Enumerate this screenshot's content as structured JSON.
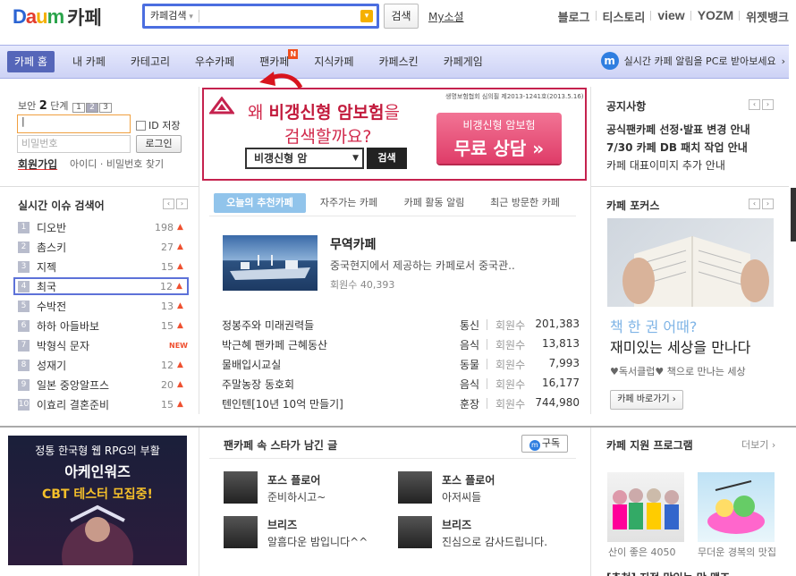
{
  "header": {
    "logo_brand": "Daum",
    "logo_service": "카페",
    "search_scope": "카페검색",
    "search_value": "",
    "search_button": "검색",
    "my_social": "My소셜",
    "links": [
      "블로그",
      "티스토리",
      "view",
      "yozm",
      "위젯뱅크"
    ]
  },
  "nav": {
    "items": [
      "카페 홈",
      "내 카페",
      "카테고리",
      "우수카페",
      "팬카페",
      "지식카페",
      "카페스킨",
      "카페게임"
    ],
    "new_badge": "N",
    "promo_icon": "m",
    "promo": "실시간 카페 알림을 PC로 받아보세요",
    "promo_arrow": "›"
  },
  "login": {
    "security_prefix": "보안",
    "security_level": "2",
    "security_suffix": "단계",
    "levels": [
      "1",
      "2",
      "3"
    ],
    "id_value": "|",
    "password_placeholder": "비밀번호",
    "save_id": "ID 저장",
    "login_button": "로그인",
    "join": "회원가입",
    "find": "아이디 · 비밀번호 찾기"
  },
  "ad": {
    "note": "생명보험협회 심의필 제2013-1241호(2013.5.16)",
    "line1_a": "왜 ",
    "line1_b": "비갱신형 암보험",
    "line1_c": "을",
    "line2": "검색할까요?",
    "select": "비갱신형 암",
    "search": "검색",
    "cta_small": "비갱신형 암보험",
    "cta_big": "무료 상담 »"
  },
  "notice": {
    "title": "공지사항",
    "items": [
      "공식팬카페 선정·발표 변경 안내",
      "7/30 카페 DB 패치 작업 안내",
      "카페 대표이미지 추가 안내"
    ]
  },
  "pager": {
    "prev": "‹",
    "next": "›"
  },
  "issues": {
    "title": "실시간 이슈 검색어",
    "up_marker": "▲",
    "items": [
      {
        "rank": "1",
        "keyword": "디오반",
        "count": "198",
        "trend": "up"
      },
      {
        "rank": "2",
        "keyword": "촘스키",
        "count": "27",
        "trend": "up"
      },
      {
        "rank": "3",
        "keyword": "지젝",
        "count": "15",
        "trend": "up"
      },
      {
        "rank": "4",
        "keyword": "최국",
        "count": "12",
        "trend": "up"
      },
      {
        "rank": "5",
        "keyword": "수박전",
        "count": "13",
        "trend": "up"
      },
      {
        "rank": "6",
        "keyword": "하하 아들바보",
        "count": "15",
        "trend": "up"
      },
      {
        "rank": "7",
        "keyword": "박형식 문자",
        "count": "",
        "trend": "NEW"
      },
      {
        "rank": "8",
        "keyword": "성재기",
        "count": "12",
        "trend": "up"
      },
      {
        "rank": "9",
        "keyword": "일본 중앙알프스",
        "count": "20",
        "trend": "up"
      },
      {
        "rank": "10",
        "keyword": "이효리 결혼준비",
        "count": "15",
        "trend": "up"
      }
    ]
  },
  "center": {
    "tabs": [
      "오늘의 추천카페",
      "자주가는 카페",
      "카페 활동 알림",
      "최근 방문한 카페"
    ],
    "feature": {
      "title": "무역카페",
      "desc": "중국현지에서 제공하는 카페로서 중국관..",
      "members_label": "회원수",
      "members": "40,393"
    },
    "member_label": "회원수",
    "rows": [
      {
        "name": "정봉주와 미래권력들",
        "cat": "통신",
        "members": "201,383"
      },
      {
        "name": "박근혜 팬카페 근혜동산",
        "cat": "음식",
        "members": "13,813"
      },
      {
        "name": "물배입시교실",
        "cat": "동물",
        "members": "7,993"
      },
      {
        "name": "주말농장 동호회",
        "cat": "음식",
        "members": "16,177"
      },
      {
        "name": "텐인텐[10년 10억 만들기]",
        "cat": "훈장",
        "members": "744,980"
      }
    ]
  },
  "focus": {
    "title": "카페 포커스",
    "headline": "책 한 권 어때?",
    "headline2": "재미있는 세상을 만나다",
    "sub": "♥독서클럽♥ 책으로 만나는 세상",
    "button": "카페 바로가기 ›"
  },
  "game_ad": {
    "line1": "정통 한국형 웹 RPG의 부활",
    "line2": "아케인워즈",
    "line3": "CBT 테스터 모집중!"
  },
  "stars": {
    "title": "팬카페 속 스타가 남긴 글",
    "subscribe_icon": "m",
    "subscribe": "구독",
    "items": [
      {
        "name": "포스 플로어",
        "msg": "준비하시고~"
      },
      {
        "name": "포스 플로어",
        "msg": "아저씨들"
      },
      {
        "name": "브리즈",
        "msg": "알흠다운 밤입니다^^"
      },
      {
        "name": "브리즈",
        "msg": "진심으로 감사드립니다."
      }
    ]
  },
  "program": {
    "title": "카페 지원 프로그램",
    "more": "더보기 ›",
    "captions": [
      "산이 좋은 4050",
      "무더운 경복의 맛집"
    ],
    "bottom_text": "[추천] 지적 맛있는 맛 맺조"
  },
  "colors": {
    "nav_active": "#5566b9",
    "search_border": "#4b6ee0",
    "ad_red": "#c5224e",
    "tab_active": "#91c4eb",
    "trend_up": "#ef5030"
  }
}
